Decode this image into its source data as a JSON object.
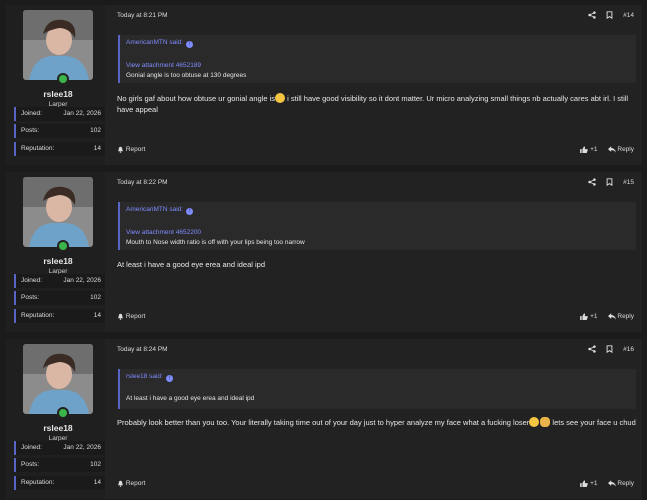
{
  "posts": [
    {
      "username": "rslee18",
      "user_title": "Larper",
      "stats": [
        {
          "label": "Joined:",
          "value": "Jan 22, 2026"
        },
        {
          "label": "Posts:",
          "value": "102"
        },
        {
          "label": "Reputation:",
          "value": "14"
        }
      ],
      "date": "Today at 8:21 PM",
      "post_number": "#14",
      "quote": {
        "author_line": "AmericanMTN said:",
        "attachment": "View attachment 4652189",
        "text": "Gonial angle is too obtuse at 130 degrees"
      },
      "message_a": "No girls gaf about how obtuse ur gonial angle is",
      "message_b": " i still have good visibility so it dont matter. Ur micro analyzing small things nb actually cares abt irl. I still have appeal",
      "report": "Report",
      "like_count": "+1",
      "reply": "Reply"
    },
    {
      "username": "rslee18",
      "user_title": "Larper",
      "stats": [
        {
          "label": "Joined:",
          "value": "Jan 22, 2026"
        },
        {
          "label": "Posts:",
          "value": "102"
        },
        {
          "label": "Reputation:",
          "value": "14"
        }
      ],
      "date": "Today at 8:22 PM",
      "post_number": "#15",
      "quote": {
        "author_line": "AmericanMTN said:",
        "attachment": "View attachment 4652200",
        "text": "Mouth to Nose width ratio is off with your lips being too narrow"
      },
      "message": "At least i have a good eye erea and ideal ipd",
      "report": "Report",
      "like_count": "+1",
      "reply": "Reply"
    },
    {
      "username": "rslee18",
      "user_title": "Larper",
      "stats": [
        {
          "label": "Joined:",
          "value": "Jan 22, 2026"
        },
        {
          "label": "Posts:",
          "value": "102"
        },
        {
          "label": "Reputation:",
          "value": "14"
        }
      ],
      "date": "Today at 8:24 PM",
      "post_number": "#16",
      "quote": {
        "author_line": "rslee18 said:",
        "text": "At least i have a good eye erea and ideal ipd"
      },
      "message_a": "Probably look better than you too. Your literally taking time out of your day just to hyper analyze my face what a fucking loser",
      "message_b": " lets see your face u chud",
      "report": "Report",
      "like_count": "+1",
      "reply": "Reply"
    }
  ],
  "icons": {
    "share": "share-icon",
    "bookmark": "bookmark-icon",
    "bell": "bell-icon",
    "like": "thumbs-up-icon",
    "reply": "reply-arrow-icon",
    "quote_arrow": "arrow-up-circle-icon"
  },
  "colors": {
    "accent": "#5865c4",
    "link": "#7f8cff",
    "online": "#3bb54a"
  }
}
